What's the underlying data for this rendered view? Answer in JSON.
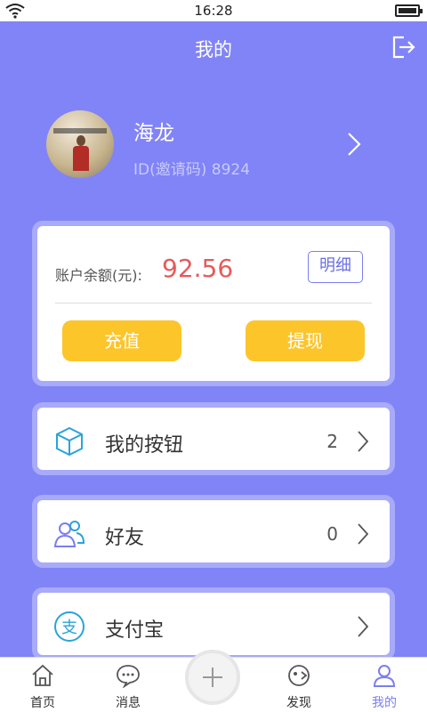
{
  "status_bar": {
    "time": "16:28",
    "battery_level": 0.85
  },
  "header": {
    "title": "我的",
    "logout_icon": "logout-icon"
  },
  "profile": {
    "name": "海龙",
    "id_text": "ID(邀请码) 8924"
  },
  "balance": {
    "label": "账户余额(元):",
    "value": "92.56",
    "detail_label": "明细",
    "recharge_label": "充值",
    "withdraw_label": "提现"
  },
  "menu": {
    "items": [
      {
        "icon": "cube-icon",
        "label": "我的按钮",
        "count": "2"
      },
      {
        "icon": "friends-icon",
        "label": "好友",
        "count": "0"
      },
      {
        "icon": "alipay-icon",
        "label": "支付宝",
        "count": ""
      }
    ]
  },
  "tabs": [
    {
      "icon": "home-icon",
      "label": "首页"
    },
    {
      "icon": "message-icon",
      "label": "消息"
    },
    {
      "icon": "plus-icon",
      "label": ""
    },
    {
      "icon": "discover-icon",
      "label": "发现"
    },
    {
      "icon": "user-icon",
      "label": "我的"
    }
  ],
  "colors": {
    "background": "#8184f6",
    "accent": "#7b7ef0",
    "button_yellow": "#fcc52a",
    "balance_red": "#e55a5a"
  }
}
